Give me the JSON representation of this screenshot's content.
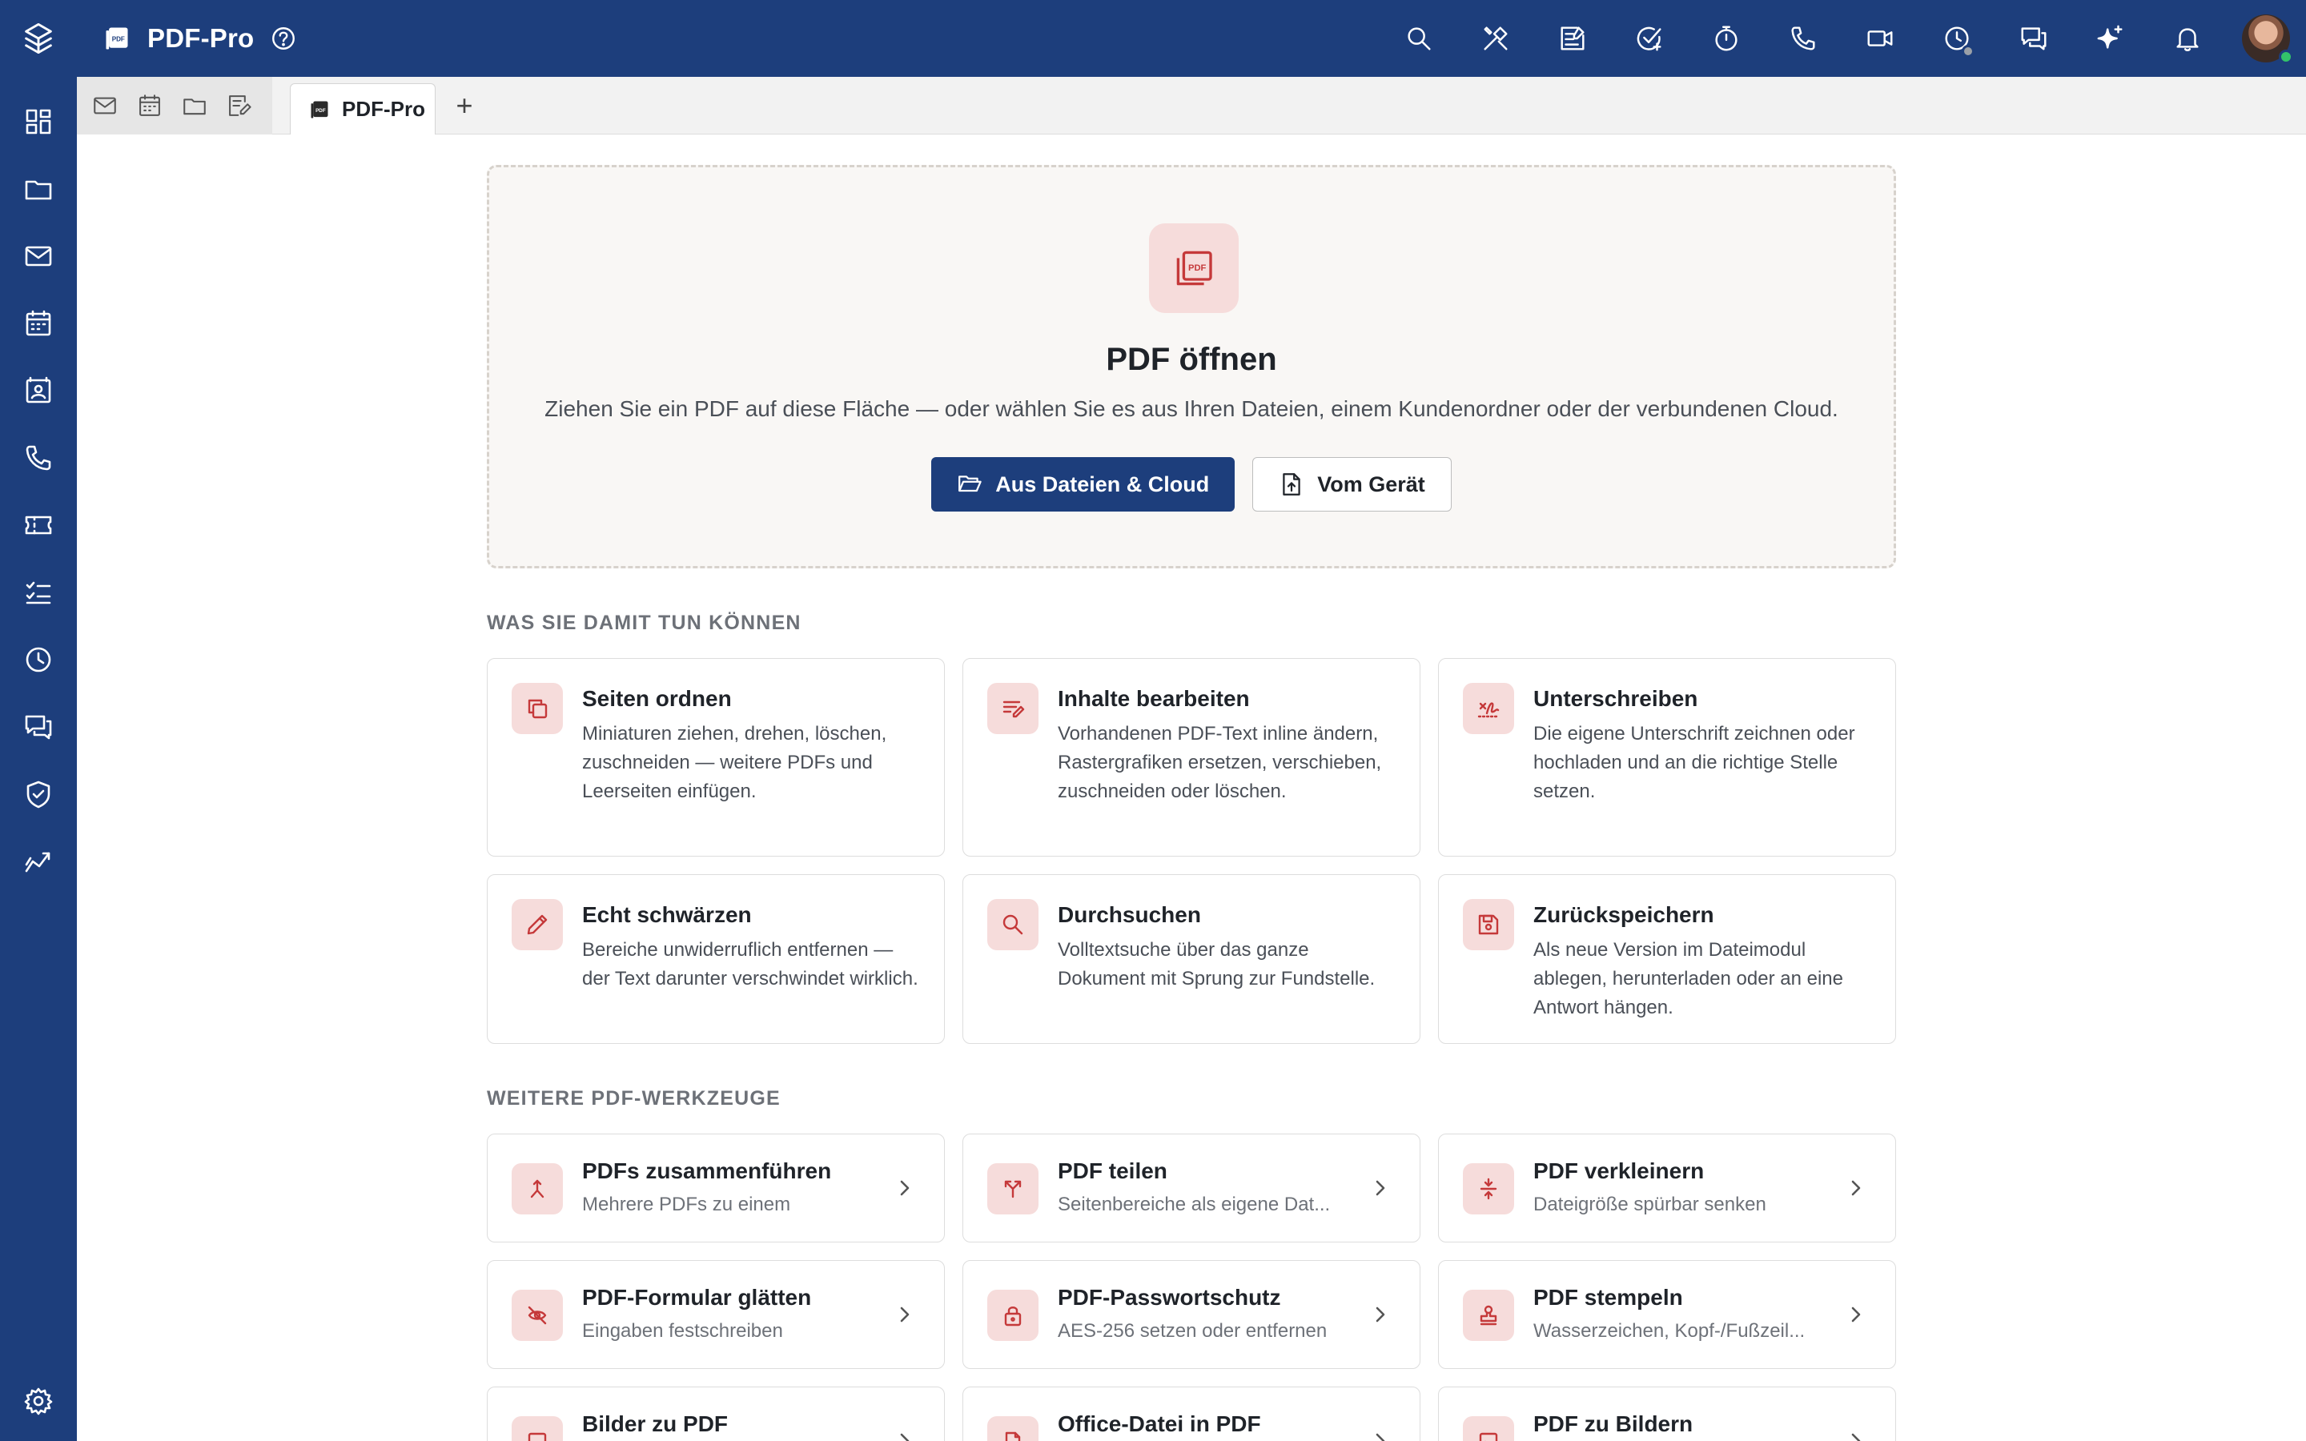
{
  "app": {
    "title": "PDF-Pro",
    "tab_label": "PDF-Pro",
    "new_tab": "+",
    "accent": "#1d3e7c",
    "icon_tint": "#c5393a",
    "badge_bg": "#f6dcdb"
  },
  "rail": {
    "logo": "app-logo-icon",
    "items": [
      "dashboard-icon",
      "folder-icon",
      "mail-icon",
      "calendar-icon",
      "contacts-icon",
      "phone-icon",
      "ticket-icon",
      "tasks-icon",
      "clock-icon",
      "chat-icon",
      "shield-icon",
      "analytics-icon"
    ],
    "settings": "settings-icon"
  },
  "topbar": {
    "actions": [
      "search-icon",
      "tools-icon",
      "notes-icon",
      "task-add-icon",
      "timer-icon",
      "phone-icon",
      "video-icon",
      "time-tracking-icon",
      "chat-icon",
      "ai-sparkle-icon",
      "bell-icon"
    ],
    "user_status": "online"
  },
  "tabstrip": {
    "quick": [
      "mail-icon",
      "calendar-icon",
      "folder-icon",
      "edit-document-icon"
    ]
  },
  "open": {
    "title": "PDF öffnen",
    "description": "Ziehen Sie ein PDF auf diese Fläche — oder wählen Sie es aus Ihren Dateien, einem Kundenordner oder der verbundenen Cloud.",
    "primary_button": "Aus Dateien & Cloud",
    "secondary_button": "Vom Gerät"
  },
  "features": {
    "heading": "WAS SIE DAMIT TUN KÖNNEN",
    "items": [
      {
        "title": "Seiten ordnen",
        "description": "Miniaturen ziehen, drehen, löschen, zuschneiden — weitere PDFs und Leerseiten einfügen.",
        "icon": "pages-icon"
      },
      {
        "title": "Inhalte bearbeiten",
        "description": "Vorhandenen PDF-Text inline ändern, Rastergrafiken ersetzen, verschieben, zuschneiden oder löschen.",
        "icon": "edit-text-icon"
      },
      {
        "title": "Unterschreiben",
        "description": "Die eigene Unterschrift zeichnen oder hochladen und an die richtige Stelle setzen.",
        "icon": "signature-icon"
      },
      {
        "title": "Echt schwärzen",
        "description": "Bereiche unwiderruflich entfernen — der Text darunter verschwindet wirklich.",
        "icon": "pen-icon"
      },
      {
        "title": "Durchsuchen",
        "description": "Volltextsuche über das ganze Dokument mit Sprung zur Fundstelle.",
        "icon": "search-icon"
      },
      {
        "title": "Zurückspeichern",
        "description": "Als neue Version im Dateimodul ablegen, herunterladen oder an eine Antwort hängen.",
        "icon": "save-icon"
      }
    ]
  },
  "tools": {
    "heading": "WEITERE PDF-WERKZEUGE",
    "items": [
      {
        "title": "PDFs zusammenführen",
        "subtitle": "Mehrere PDFs zu einem",
        "icon": "merge-icon"
      },
      {
        "title": "PDF teilen",
        "subtitle": "Seitenbereiche als eigene Dat...",
        "icon": "split-icon"
      },
      {
        "title": "PDF verkleinern",
        "subtitle": "Dateigröße spürbar senken",
        "icon": "compress-icon"
      },
      {
        "title": "PDF-Formular glätten",
        "subtitle": "Eingaben festschreiben",
        "icon": "flatten-icon"
      },
      {
        "title": "PDF-Passwortschutz",
        "subtitle": "AES-256 setzen oder entfernen",
        "icon": "lock-icon"
      },
      {
        "title": "PDF stempeln",
        "subtitle": "Wasserzeichen, Kopf-/Fußzeil...",
        "icon": "stamp-icon"
      },
      {
        "title": "Bilder zu PDF",
        "subtitle": "",
        "icon": "image-pdf-icon"
      },
      {
        "title": "Office-Datei in PDF",
        "subtitle": "",
        "icon": "office-file-icon"
      },
      {
        "title": "PDF zu Bildern",
        "subtitle": "",
        "icon": "pdf-image-icon"
      }
    ]
  }
}
